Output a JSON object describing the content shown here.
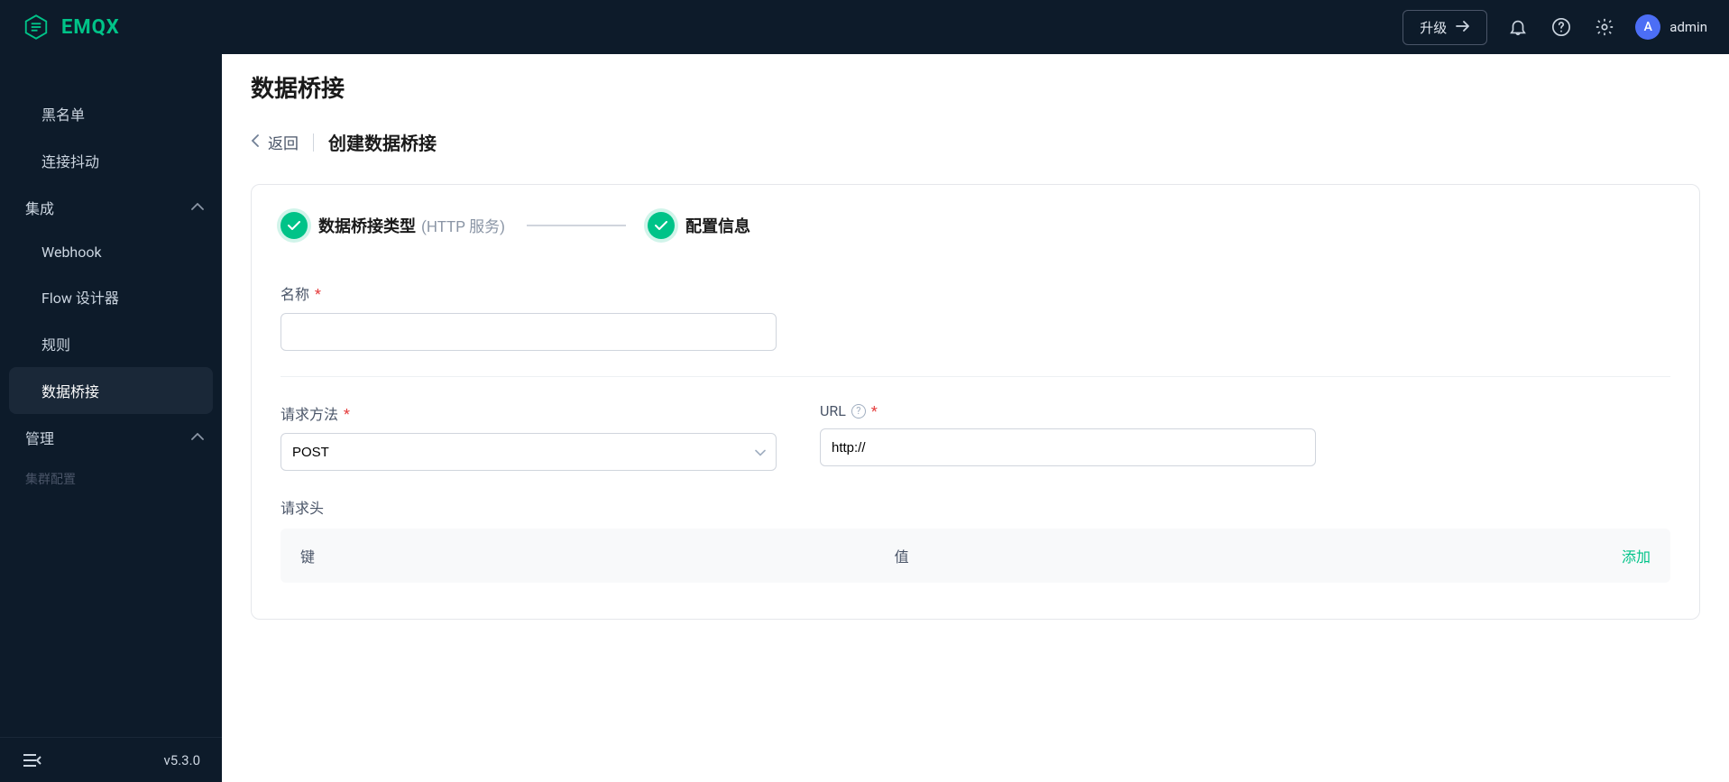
{
  "brand": {
    "name": "EMQX"
  },
  "topbar": {
    "upgrade_label": "升级",
    "username": "admin",
    "avatar_initial": "A"
  },
  "sidebar": {
    "items": [
      {
        "label": "黑名单",
        "type": "item"
      },
      {
        "label": "连接抖动",
        "type": "item"
      },
      {
        "label": "集成",
        "type": "group",
        "expanded": true
      },
      {
        "label": "Webhook",
        "type": "item"
      },
      {
        "label": "Flow 设计器",
        "type": "item"
      },
      {
        "label": "规则",
        "type": "item"
      },
      {
        "label": "数据桥接",
        "type": "item",
        "active": true
      },
      {
        "label": "管理",
        "type": "group",
        "expanded": true
      }
    ],
    "truncated_label": "集群配置",
    "version": "v5.3.0"
  },
  "page": {
    "title": "数据桥接",
    "back_label": "返回",
    "breadcrumb_current": "创建数据桥接"
  },
  "steps": [
    {
      "label": "数据桥接类型",
      "sublabel": "(HTTP 服务)",
      "done": true
    },
    {
      "label": "配置信息",
      "done": true
    }
  ],
  "form": {
    "name_label": "名称",
    "name_value": "",
    "method_label": "请求方法",
    "method_value": "POST",
    "url_label": "URL",
    "url_value": "http://",
    "headers_label": "请求头",
    "headers_key_col": "键",
    "headers_val_col": "值",
    "headers_add": "添加"
  }
}
